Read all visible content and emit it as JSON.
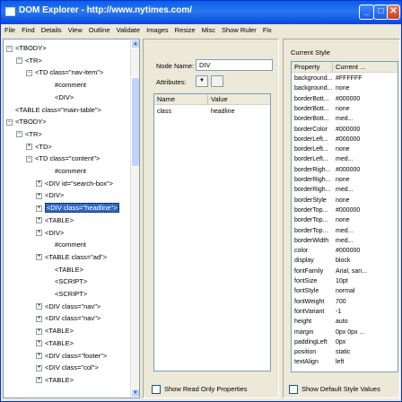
{
  "window": {
    "title": "DOM Explorer - http://www.nytimes.com/"
  },
  "titlebar_buttons": {
    "minimize": "_",
    "maximize": "□",
    "close": "✕"
  },
  "menu": [
    "File",
    "Find",
    "Details",
    "View",
    "Outline",
    "Validate",
    "Images",
    "Resize",
    "Misc",
    "Show Ruler",
    "Fix"
  ],
  "tree": [
    {
      "label": "<TBODY>",
      "expander": "-",
      "indent": 0
    },
    {
      "label": "<TR>",
      "expander": "-",
      "indent": 1
    },
    {
      "label": "<TD class=\"nav-item\">",
      "expander": "-",
      "indent": 2
    },
    {
      "label": "#comment",
      "expander": "",
      "indent": 4
    },
    {
      "label": "<DIV>",
      "expander": "",
      "indent": 4
    },
    {
      "label": "<TABLE class=\"main-table\">",
      "expander": "",
      "indent": 0
    },
    {
      "label": "<TBODY>",
      "expander": "-",
      "indent": 0
    },
    {
      "label": "<TR>",
      "expander": "-",
      "indent": 1
    },
    {
      "label": "<TD>",
      "expander": "x",
      "indent": 2
    },
    {
      "label": "<TD class=\"content\">",
      "expander": "-",
      "indent": 2
    },
    {
      "label": "#comment",
      "expander": "",
      "indent": 4
    },
    {
      "label": "<DIV id=\"search-box\">",
      "expander": "+",
      "indent": 3
    },
    {
      "label": "<DIV>",
      "expander": "+",
      "indent": 3
    },
    {
      "label": "<DIV class=\"headline\">",
      "expander": "+",
      "indent": 3,
      "selected": true
    },
    {
      "label": "<TABLE>",
      "expander": "+",
      "indent": 3
    },
    {
      "label": "<DIV>",
      "expander": "+",
      "indent": 3
    },
    {
      "label": "#comment",
      "expander": "",
      "indent": 4
    },
    {
      "label": "<TABLE class=\"ad\">",
      "expander": "+",
      "indent": 3
    },
    {
      "label": "<TABLE>",
      "expander": "",
      "indent": 4
    },
    {
      "label": "<SCRIPT>",
      "expander": "",
      "indent": 4
    },
    {
      "label": "<SCRIPT>",
      "expander": "",
      "indent": 4
    },
    {
      "label": "<DIV class=\"nav\">",
      "expander": "+",
      "indent": 3
    },
    {
      "label": "<DIV class=\"nav\">",
      "expander": "+",
      "indent": 3
    },
    {
      "label": "<TABLE>",
      "expander": "+",
      "indent": 3
    },
    {
      "label": "<TABLE>",
      "expander": "+",
      "indent": 3
    },
    {
      "label": "<DIV class=\"footer\">",
      "expander": "+",
      "indent": 3
    },
    {
      "label": "<DIV class=\"col\">",
      "expander": "+",
      "indent": 3
    },
    {
      "label": "<TABLE>",
      "expander": "+",
      "indent": 3
    }
  ],
  "node_details": {
    "node_name_label": "Node Name:",
    "node_name_value": "DIV",
    "attributes_label": "Attributes:",
    "columns": [
      "Name",
      "Value"
    ],
    "rows": [
      {
        "name": "class",
        "value": "headline"
      }
    ],
    "show_read_only": "Show Read Only Properties"
  },
  "current_style": {
    "title": "Current Style",
    "columns": [
      "Property",
      "Current ..."
    ],
    "rows": [
      {
        "property": "background...",
        "value": "#FFFFFF"
      },
      {
        "property": "background...",
        "value": "none"
      },
      {
        "property": "borderBott...",
        "value": "#000000"
      },
      {
        "property": "borderBott...",
        "value": "none"
      },
      {
        "property": "borderBott...",
        "value": "med..."
      },
      {
        "property": "borderColor",
        "value": "#000000"
      },
      {
        "property": "borderLeft...",
        "value": "#000000"
      },
      {
        "property": "borderLeft...",
        "value": "none"
      },
      {
        "property": "borderLeft...",
        "value": "med..."
      },
      {
        "property": "borderRigh...",
        "value": "#000000"
      },
      {
        "property": "borderRigh...",
        "value": "none"
      },
      {
        "property": "borderRigh...",
        "value": "med..."
      },
      {
        "property": "borderStyle",
        "value": "none"
      },
      {
        "property": "borderTop...",
        "value": "#000000"
      },
      {
        "property": "borderTop...",
        "value": "none"
      },
      {
        "property": "borderTop...",
        "value": "med..."
      },
      {
        "property": "borderWidth",
        "value": "med..."
      },
      {
        "property": "color",
        "value": "#000000"
      },
      {
        "property": "display",
        "value": "block"
      },
      {
        "property": "fontFamily",
        "value": "Arial, san..."
      },
      {
        "property": "fontSize",
        "value": "10pt"
      },
      {
        "property": "fontStyle",
        "value": "normal"
      },
      {
        "property": "fontWeight",
        "value": "700"
      },
      {
        "property": "fontVariant",
        "value": "-1"
      },
      {
        "property": "height",
        "value": "auto"
      },
      {
        "property": "margin",
        "value": "0px 0px ..."
      },
      {
        "property": "paddingLeft",
        "value": "0px"
      },
      {
        "property": "position",
        "value": "static"
      },
      {
        "property": "textAlign",
        "value": "left"
      }
    ],
    "show_default": "Show Default Style Values"
  }
}
